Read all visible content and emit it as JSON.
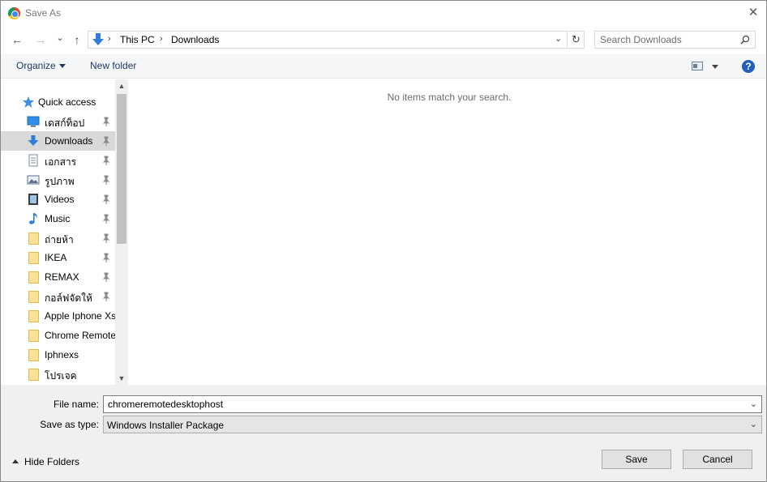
{
  "window": {
    "title": "Save As",
    "close_glyph": "✕"
  },
  "nav": {
    "back": "←",
    "forward": "→",
    "recent": "⌄",
    "up": "↑",
    "refresh": "↻"
  },
  "address": {
    "sep": "›",
    "crumbs": [
      "This PC",
      "Downloads"
    ],
    "dropdown": "⌄"
  },
  "search": {
    "placeholder": "Search Downloads"
  },
  "toolbar": {
    "organize": "Organize",
    "new_folder": "New folder",
    "help": "?"
  },
  "sidebar": {
    "items": [
      {
        "label": "Quick access",
        "icon": "star-icon"
      },
      {
        "label": "เดสก์ท็อป",
        "icon": "desktop-icon",
        "pinned": true
      },
      {
        "label": "Downloads",
        "icon": "download-icon",
        "pinned": true,
        "selected": true
      },
      {
        "label": "เอกสาร",
        "icon": "document-icon",
        "pinned": true
      },
      {
        "label": "รูปภาพ",
        "icon": "pictures-icon",
        "pinned": true
      },
      {
        "label": "Videos",
        "icon": "video-icon",
        "pinned": true
      },
      {
        "label": "Music",
        "icon": "music-icon",
        "pinned": true
      },
      {
        "label": "ถ่ายห้า",
        "icon": "folder-icon",
        "pinned": true
      },
      {
        "label": "IKEA",
        "icon": "folder-icon",
        "pinned": true
      },
      {
        "label": "REMAX",
        "icon": "folder-icon",
        "pinned": true
      },
      {
        "label": "กอล์ฟจัดให้",
        "icon": "folder-icon",
        "pinned": true
      },
      {
        "label": "Apple Iphone Xs",
        "icon": "folder-icon"
      },
      {
        "label": "Chrome Remote",
        "icon": "folder-icon"
      },
      {
        "label": "Iphnexs",
        "icon": "folder-icon"
      },
      {
        "label": "โปรเจค",
        "icon": "folder-icon"
      }
    ]
  },
  "content": {
    "empty_message": "No items match your search."
  },
  "form": {
    "filename_label": "File name:",
    "filename_value": "chromeremotedesktophost",
    "savetype_label": "Save as type:",
    "savetype_value": "Windows Installer Package",
    "caret": "⌄"
  },
  "footer": {
    "hide_folders": "Hide Folders",
    "save": "Save",
    "cancel": "Cancel"
  },
  "scroll": {
    "up": "▲",
    "down": "▼"
  },
  "colors": {
    "selected_bg": "#d9d9d9",
    "link": "#1e3966",
    "help": "#1f5fbf"
  }
}
